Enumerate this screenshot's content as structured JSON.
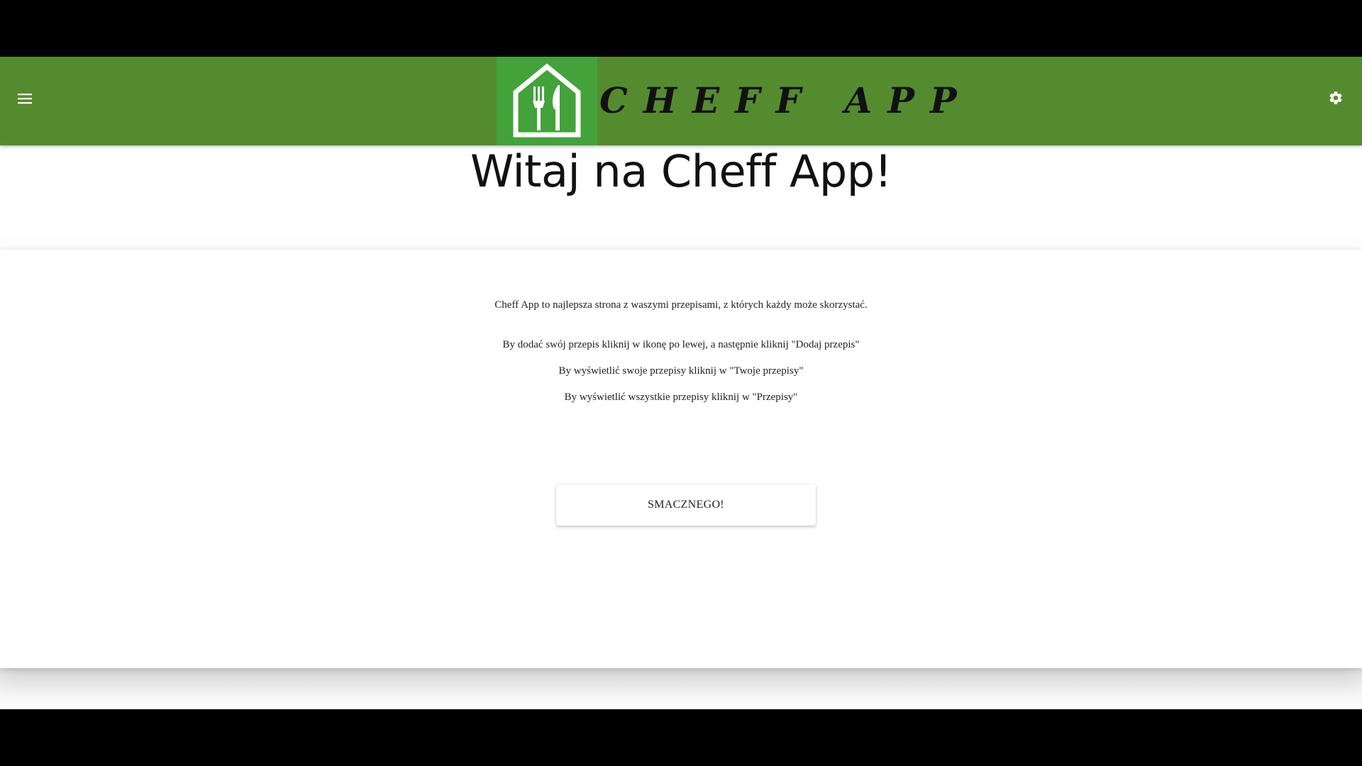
{
  "app": {
    "brand_name": "CHEFF APP",
    "brand_color": "#558b2f",
    "logo_bg_color": "#43a23a"
  },
  "toolbar": {
    "menu_icon": "hamburger-menu-icon",
    "settings_icon": "gear-icon",
    "logo_icon": "house-fork-knife-icon"
  },
  "hero": {
    "title": "Witaj na Cheff App!"
  },
  "content": {
    "intro": "Cheff App to najlepsza strona z waszymi przepisami, z których każdy może skorzystać.",
    "instructions": [
      "By dodać swój przepis kliknij w ikonę po lewej, a następnie kliknij \"Dodaj przepis\"",
      "By wyświetlić swoje przepisy kliknij w \"Twoje przepisy\"",
      "By wyświetlić wszystkie przepisy kliknij w \"Przepisy\""
    ],
    "cta_label": "SMACZNEGO!"
  }
}
